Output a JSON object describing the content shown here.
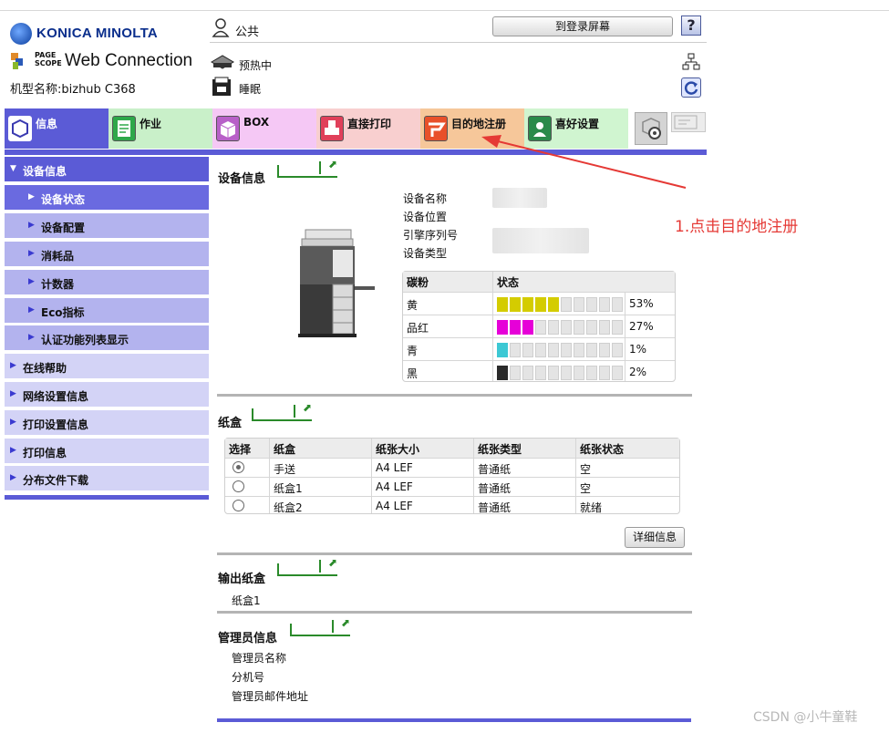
{
  "header": {
    "brand": "KONICA MINOLTA",
    "pagescope_top": "PAGE",
    "pagescope_bottom": "SCOPE",
    "product": "Web Connection",
    "model": "机型名称:bizhub C368",
    "user": "公共",
    "status_warmup": "预热中",
    "status_sleep": "睡眠",
    "login_button": "到登录屏幕",
    "help": "?"
  },
  "tabs": [
    {
      "label": "信息",
      "color": "#5b5bd6"
    },
    {
      "label": "作业",
      "color": "#c9f0c9"
    },
    {
      "label": "BOX",
      "color": "#f5c8f5"
    },
    {
      "label": "直接打印",
      "color": "#f8cfcf"
    },
    {
      "label": "目的地注册",
      "color": "#f6c79a"
    },
    {
      "label": "喜好设置",
      "color": "#d0f5d0"
    }
  ],
  "sidebar": {
    "items": [
      {
        "label": "设备信息"
      },
      {
        "label": "设备状态"
      },
      {
        "label": "设备配置"
      },
      {
        "label": "消耗品"
      },
      {
        "label": "计数器"
      },
      {
        "label": "Eco指标"
      },
      {
        "label": "认证功能列表显示"
      },
      {
        "label": "在线帮助"
      },
      {
        "label": "网络设置信息"
      },
      {
        "label": "打印设置信息"
      },
      {
        "label": "打印信息"
      },
      {
        "label": "分布文件下载"
      }
    ]
  },
  "device_info": {
    "title": "设备信息",
    "labels": [
      "设备名称",
      "设备位置",
      "引擎序列号",
      "设备类型"
    ]
  },
  "toner": {
    "col_toner": "碳粉",
    "col_status": "状态",
    "rows": [
      {
        "name": "黄",
        "percent": "53%",
        "level": 0.53,
        "color": "#d4cc00"
      },
      {
        "name": "品红",
        "percent": "27%",
        "level": 0.27,
        "color": "#e600d8"
      },
      {
        "name": "青",
        "percent": "1%",
        "level": 0.01,
        "color": "#3cc8d4"
      },
      {
        "name": "黑",
        "percent": "2%",
        "level": 0.02,
        "color": "#2a2a2a"
      }
    ]
  },
  "tray": {
    "title": "纸盒",
    "headers": [
      "选择",
      "纸盒",
      "纸张大小",
      "纸张类型",
      "纸张状态"
    ],
    "rows": [
      {
        "tray": "手送",
        "size": "A4 LEF",
        "type": "普通纸",
        "status": "空",
        "selected": true
      },
      {
        "tray": "纸盒1",
        "size": "A4 LEF",
        "type": "普通纸",
        "status": "空",
        "selected": false
      },
      {
        "tray": "纸盒2",
        "size": "A4 LEF",
        "type": "普通纸",
        "status": "就绪",
        "selected": false
      }
    ],
    "details_button": "详细信息"
  },
  "output_tray": {
    "title": "输出纸盒",
    "value": "纸盒1"
  },
  "admin_info": {
    "title": "管理员信息",
    "labels": [
      "管理员名称",
      "分机号",
      "管理员邮件地址"
    ]
  },
  "annotation": "1.点击目的地注册",
  "watermark": "CSDN @小牛童鞋",
  "colors": {
    "accent": "#5b5bd6",
    "annotation": "#e53935",
    "section_green": "#2a8a2a"
  }
}
